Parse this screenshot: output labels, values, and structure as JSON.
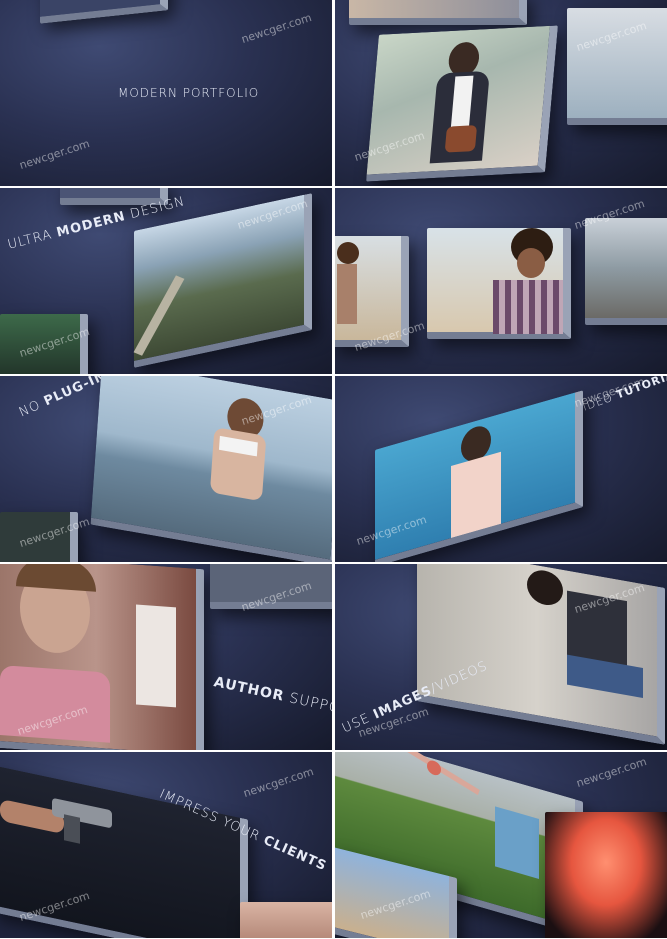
{
  "captions": {
    "f0": "MODERN PORTFOLIO",
    "f2_a": "ULTRA",
    "f2_b": "MODERN",
    "f2_c": "DESIGN",
    "f4_a": "NO",
    "f4_b": "PLUG-INS",
    "f5_a": "VIDEO",
    "f5_b": "TUTORIAL",
    "f6_a": "AUTHOR",
    "f6_b": "SUPPORT",
    "f7_a": "USE",
    "f7_b": "IMAGES",
    "f7_c": "/VIDEOS",
    "f8_a": "IMPRESS YOUR",
    "f8_b": "CLIENTS"
  },
  "watermark": "newcger.com",
  "colors": {
    "background": "#2a3152",
    "caption": "#e8ecf7",
    "block_edge": "#9aa3b6"
  }
}
